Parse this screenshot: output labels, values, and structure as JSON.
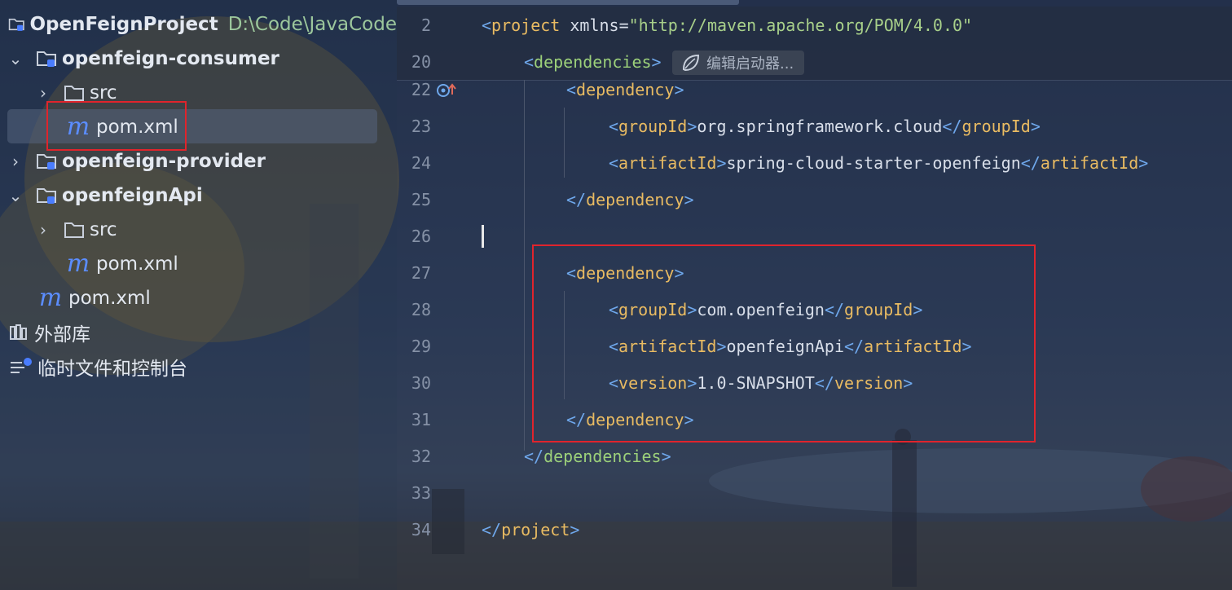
{
  "project_tree": {
    "root": {
      "name": "OpenFeignProject",
      "path": "D:\\Code\\JavaCode"
    },
    "consumer": {
      "name": "openfeign-consumer",
      "src": "src",
      "pom": "pom.xml"
    },
    "provider": {
      "name": "openfeign-provider"
    },
    "api": {
      "name": "openfeignApi",
      "src": "src",
      "pom": "pom.xml"
    },
    "root_pom": "pom.xml",
    "external_libs": "外部库",
    "scratches": "临时文件和控制台"
  },
  "editor": {
    "hint": "编辑启动器...",
    "lines": [
      {
        "n": "2",
        "parts": [
          [
            "br",
            "<"
          ],
          [
            "tag",
            "project"
          ],
          [
            "at",
            " xmlns="
          ],
          [
            "str",
            "\"http://maven.apache.org/POM/4.0.0\""
          ]
        ]
      },
      {
        "n": "20",
        "parts": [
          [
            "br",
            "<"
          ],
          [
            "green-tag",
            "dependencies"
          ],
          [
            "br",
            ">"
          ]
        ]
      },
      {
        "n": "22",
        "parts": [
          [
            "br",
            "<"
          ],
          [
            "tag",
            "dependency"
          ],
          [
            "br",
            ">"
          ]
        ]
      },
      {
        "n": "23",
        "parts": [
          [
            "br",
            "<"
          ],
          [
            "tag",
            "groupId"
          ],
          [
            "br",
            ">"
          ],
          [
            "txt",
            "org.springframework.cloud"
          ],
          [
            "br",
            "</"
          ],
          [
            "tag",
            "groupId"
          ],
          [
            "br",
            ">"
          ]
        ]
      },
      {
        "n": "24",
        "parts": [
          [
            "br",
            "<"
          ],
          [
            "tag",
            "artifactId"
          ],
          [
            "br",
            ">"
          ],
          [
            "txt",
            "spring-cloud-starter-openfeign"
          ],
          [
            "br",
            "</"
          ],
          [
            "tag",
            "artifactId"
          ],
          [
            "br",
            ">"
          ]
        ]
      },
      {
        "n": "25",
        "parts": [
          [
            "br",
            "</"
          ],
          [
            "tag",
            "dependency"
          ],
          [
            "br",
            ">"
          ]
        ]
      },
      {
        "n": "26",
        "parts": []
      },
      {
        "n": "27",
        "parts": [
          [
            "br",
            "<"
          ],
          [
            "tag",
            "dependency"
          ],
          [
            "br",
            ">"
          ]
        ]
      },
      {
        "n": "28",
        "parts": [
          [
            "br",
            "<"
          ],
          [
            "tag",
            "groupId"
          ],
          [
            "br",
            ">"
          ],
          [
            "txt",
            "com.openfeign"
          ],
          [
            "br",
            "</"
          ],
          [
            "tag",
            "groupId"
          ],
          [
            "br",
            ">"
          ]
        ]
      },
      {
        "n": "29",
        "parts": [
          [
            "br",
            "<"
          ],
          [
            "tag",
            "artifactId"
          ],
          [
            "br",
            ">"
          ],
          [
            "txt",
            "openfeignApi"
          ],
          [
            "br",
            "</"
          ],
          [
            "tag",
            "artifactId"
          ],
          [
            "br",
            ">"
          ]
        ]
      },
      {
        "n": "30",
        "parts": [
          [
            "br",
            "<"
          ],
          [
            "tag",
            "version"
          ],
          [
            "br",
            ">"
          ],
          [
            "txt",
            "1.0-SNAPSHOT"
          ],
          [
            "br",
            "</"
          ],
          [
            "tag",
            "version"
          ],
          [
            "br",
            ">"
          ]
        ]
      },
      {
        "n": "31",
        "parts": [
          [
            "br",
            "</"
          ],
          [
            "tag",
            "dependency"
          ],
          [
            "br",
            ">"
          ]
        ]
      },
      {
        "n": "32",
        "parts": [
          [
            "br",
            "</"
          ],
          [
            "green-tag",
            "dependencies"
          ],
          [
            "br",
            ">"
          ]
        ]
      },
      {
        "n": "33",
        "parts": []
      },
      {
        "n": "34",
        "parts": [
          [
            "br",
            "</"
          ],
          [
            "tag",
            "project"
          ],
          [
            "br",
            ">"
          ]
        ]
      }
    ]
  },
  "colors": {
    "highlight_box": "#e0242c",
    "tag": "#e9bb62",
    "bracket": "#6fa8ec",
    "string": "#a8d08a"
  },
  "icons": [
    "chevron-right-icon",
    "chevron-down-icon",
    "module-folder-icon",
    "folder-icon",
    "maven-icon",
    "library-icon",
    "scratches-icon",
    "spring-leaf-icon",
    "override-gutter-icon"
  ]
}
